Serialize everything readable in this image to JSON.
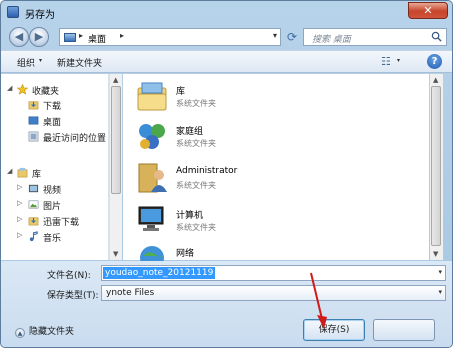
{
  "window": {
    "title": "另存为",
    "close_glyph": "✕"
  },
  "address": {
    "location": "桌面",
    "separator": "▸",
    "dropdown": "▾",
    "refresh_glyph": "⟳"
  },
  "search": {
    "placeholder": "搜索 桌面"
  },
  "toolbar": {
    "organize": "组织",
    "new_folder": "新建文件夹",
    "dropdown": "▾",
    "help_glyph": "?"
  },
  "nav": {
    "items": [
      {
        "label": "收藏夹",
        "arrow": "◢",
        "icon": "star-icon"
      },
      {
        "label": "下载",
        "arrow": "",
        "icon": "download-folder-icon"
      },
      {
        "label": "桌面",
        "arrow": "",
        "icon": "desktop-icon"
      },
      {
        "label": "最近访问的位置",
        "arrow": "",
        "icon": "recent-places-icon"
      },
      {
        "label": "库",
        "arrow": "◢",
        "icon": "library-icon"
      },
      {
        "label": "视频",
        "arrow": "▷",
        "icon": "video-library-icon"
      },
      {
        "label": "图片",
        "arrow": "▷",
        "icon": "picture-library-icon"
      },
      {
        "label": "迅雷下载",
        "arrow": "▷",
        "icon": "thunder-download-icon"
      },
      {
        "label": "音乐",
        "arrow": "▷",
        "icon": "music-library-icon"
      }
    ]
  },
  "files": {
    "items": [
      {
        "name": "库",
        "type": "系统文件夹",
        "icon": "library-folder-icon"
      },
      {
        "name": "家庭组",
        "type": "系统文件夹",
        "icon": "homegroup-icon"
      },
      {
        "name": "Administrator",
        "type": "系统文件夹",
        "icon": "user-folder-icon"
      },
      {
        "name": "计算机",
        "type": "系统文件夹",
        "icon": "computer-icon"
      },
      {
        "name": "网络",
        "type": "",
        "icon": "network-icon"
      }
    ]
  },
  "form": {
    "filename_label": "文件名(N):",
    "filename_value": "youdao_note_20121119",
    "filetype_label": "保存类型(T):",
    "filetype_value": "ynote Files",
    "dropdown": "▾"
  },
  "footer": {
    "hide_folders": "隐藏文件夹",
    "save_button": "保存(S)"
  },
  "colors": {
    "accent": "#3399ff",
    "annotation_arrow": "#d11a1a"
  }
}
